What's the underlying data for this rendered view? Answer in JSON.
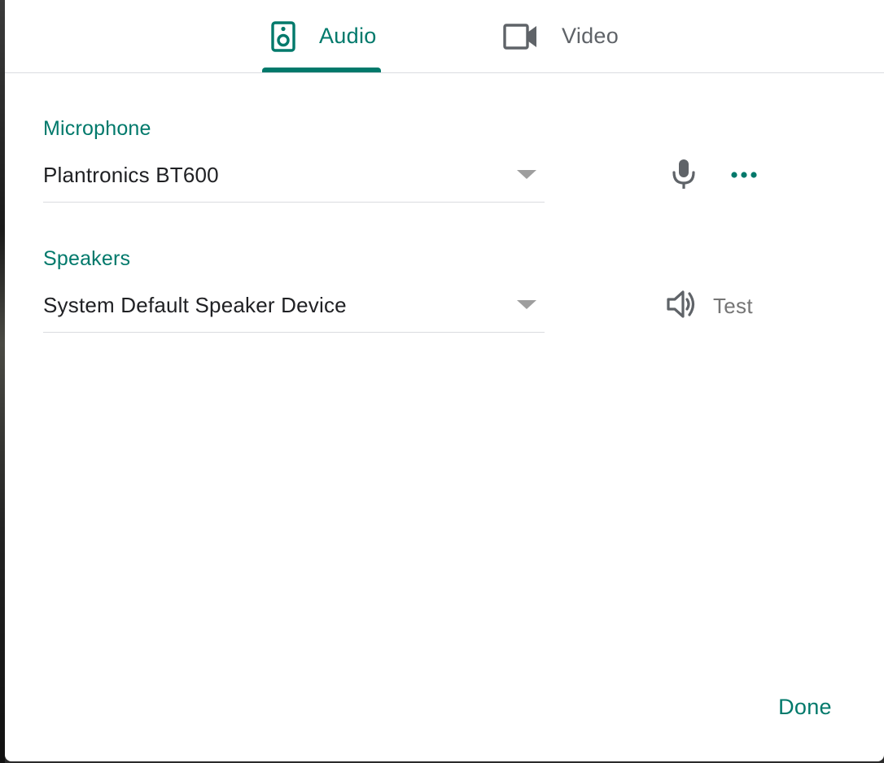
{
  "tabs": [
    {
      "label": "Audio",
      "icon": "speaker-device-icon",
      "active": true
    },
    {
      "label": "Video",
      "icon": "videocam-icon",
      "active": false
    }
  ],
  "microphone": {
    "label": "Microphone",
    "selected": "Plantronics BT600",
    "icons": [
      "mic-icon",
      "more-horiz-icon"
    ]
  },
  "speakers": {
    "label": "Speakers",
    "selected": "System Default Speaker Device",
    "test_label": "Test",
    "icon": "volume-icon"
  },
  "footer": {
    "done_label": "Done"
  },
  "colors": {
    "accent": "#00796b",
    "text": "#202124",
    "muted": "#5f6368",
    "divider": "#dadce0"
  }
}
